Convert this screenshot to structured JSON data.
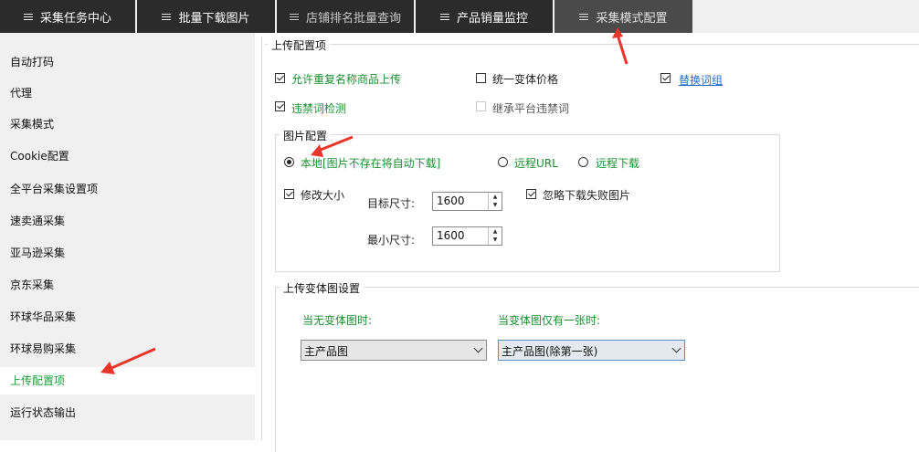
{
  "tabs": [
    {
      "label": "采集任务中心"
    },
    {
      "label": "批量下载图片"
    },
    {
      "label": "店铺排名批量查询"
    },
    {
      "label": "产品销量监控"
    },
    {
      "label": "采集模式配置"
    }
  ],
  "sidebar": {
    "items": [
      {
        "label": "自动打码"
      },
      {
        "label": "代理"
      },
      {
        "label": "采集模式"
      },
      {
        "label": "Cookie配置"
      },
      {
        "label": "全平台采集设置项"
      },
      {
        "label": "速卖通采集"
      },
      {
        "label": "亚马逊采集"
      },
      {
        "label": "京东采集"
      },
      {
        "label": "环球华品采集"
      },
      {
        "label": "环球易购采集"
      },
      {
        "label": "上传配置项"
      },
      {
        "label": "运行状态输出"
      }
    ],
    "active_index": 10
  },
  "upload": {
    "title": "上传配置项",
    "allow_duplicate": {
      "label": "允许重复名称商品上传",
      "checked": true
    },
    "unify_variant_price": {
      "label": "统一变体价格",
      "checked": false
    },
    "replace_words": {
      "label": "替换词组",
      "checked": true
    },
    "forbidden_check": {
      "label": "违禁词检测",
      "checked": true
    },
    "inherit_forbidden": {
      "label": "继承平台违禁词",
      "checked": false,
      "disabled": true
    }
  },
  "image": {
    "title": "图片配置",
    "local": {
      "label": "本地[图片不存在将自动下载]",
      "checked": true
    },
    "remote_url": {
      "label": "远程URL",
      "checked": false
    },
    "remote_download": {
      "label": "远程下载",
      "checked": false
    },
    "resize": {
      "label": "修改大小",
      "checked": true
    },
    "ignore_failed": {
      "label": "忽略下载失败图片",
      "checked": true
    },
    "target_size": {
      "label": "目标尺寸:",
      "value": "1600"
    },
    "min_size": {
      "label": "最小尺寸:",
      "value": "1600"
    }
  },
  "variant": {
    "title": "上传变体图设置",
    "no_variant": {
      "label": "当无变体图时:",
      "value": "主产品图"
    },
    "one_variant": {
      "label": "当变体图仅有一张时:",
      "value": "主产品图(除第一张)"
    }
  },
  "colors": {
    "active_green": "#1a8f2f",
    "tab_bg": "#2b2b2b",
    "link_blue": "#1f6fc9",
    "arrow_red": "#e8362b"
  }
}
